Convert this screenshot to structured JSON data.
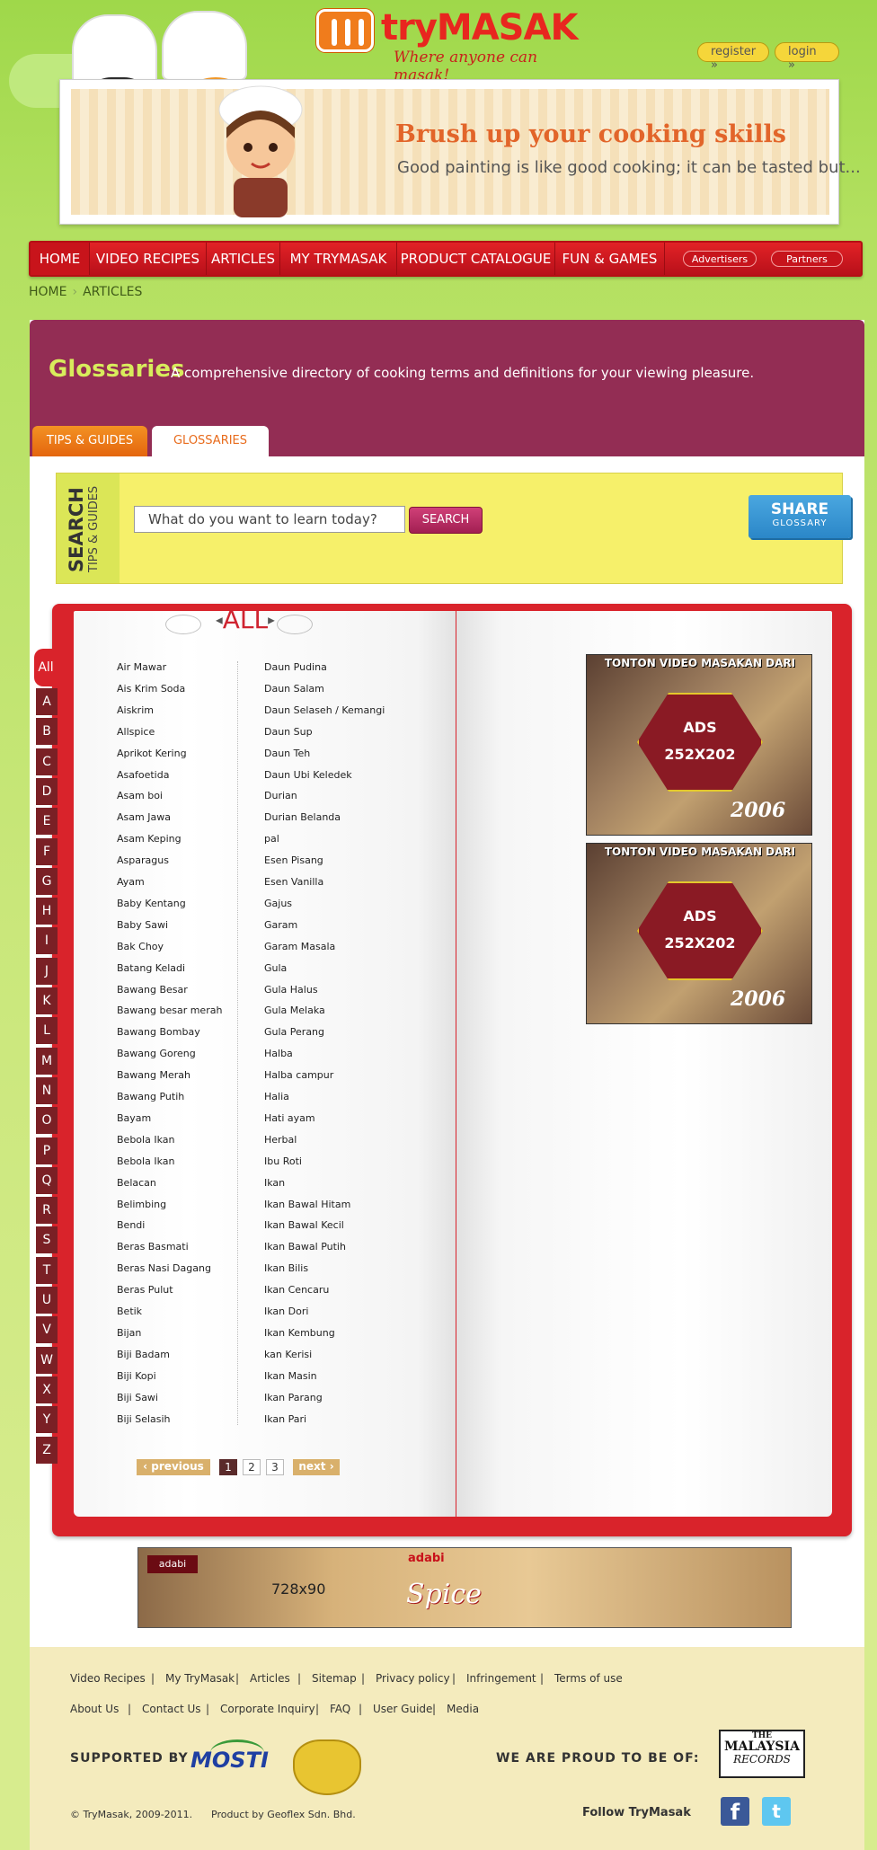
{
  "header": {
    "logo_text": "tryMASAK",
    "logo_tagline": "Where anyone can masak!",
    "register_label": "register »",
    "login_label": "login »"
  },
  "banner": {
    "title": "Brush up your cooking skills",
    "subtitle": "Good painting is like good cooking; it can be tasted but..."
  },
  "nav": {
    "items": [
      "HOME",
      "VIDEO RECIPES",
      "ARTICLES",
      "MY TRYMASAK",
      "PRODUCT CATALOGUE",
      "FUN & GAMES"
    ],
    "advertisers_label": "Advertisers",
    "partners_label": "Partners"
  },
  "breadcrumb": [
    "HOME",
    "ARTICLES"
  ],
  "section": {
    "title": "Glossaries",
    "description": "A comprehensive directory of cooking terms and definitions for your viewing pleasure."
  },
  "tabs": {
    "tips_label": "TIPS & GUIDES",
    "glossaries_label": "GLOSSARIES"
  },
  "search": {
    "side_title": "SEARCH",
    "side_subtitle": "TIPS & GUIDES",
    "input_value": "What do you want to learn today?",
    "button_label": "SEARCH",
    "share_title": "SHARE",
    "share_subtitle": "GLOSSARY"
  },
  "glossary": {
    "heading": "ALL",
    "letters": [
      "All",
      "A",
      "B",
      "C",
      "D",
      "E",
      "F",
      "G",
      "H",
      "I",
      "J",
      "K",
      "L",
      "M",
      "N",
      "O",
      "P",
      "Q",
      "R",
      "S",
      "T",
      "U",
      "V",
      "W",
      "X",
      "Y",
      "Z"
    ],
    "column1": [
      "Air Mawar",
      "Ais Krim Soda",
      "Aiskrim",
      "Allspice",
      "Aprikot Kering",
      "Asafoetida",
      "Asam boi",
      "Asam Jawa",
      "Asam Keping",
      "Asparagus",
      "Ayam",
      "Baby Kentang",
      "Baby Sawi",
      "Bak Choy",
      "Batang Keladi",
      "Bawang Besar",
      "Bawang besar merah",
      "Bawang Bombay",
      "Bawang Goreng",
      "Bawang Merah",
      "Bawang Putih",
      "Bayam",
      "Bebola Ikan",
      "Bebola Ikan",
      "Belacan",
      "Belimbing",
      "Bendi",
      "Beras Basmati",
      "Beras Nasi Dagang",
      "Beras Pulut",
      "Betik",
      "Bijan",
      "Biji Badam",
      "Biji Kopi",
      "Biji Sawi",
      "Biji Selasih"
    ],
    "column2": [
      "Daun Pudina",
      "Daun Salam",
      "Daun Selaseh / Kemangi",
      "Daun Sup",
      "Daun Teh",
      "Daun Ubi Keledek",
      "Durian",
      "Durian Belanda",
      " pal",
      "Esen Pisang",
      "Esen Vanilla",
      "Gajus",
      "Garam",
      "Garam Masala",
      "Gula",
      "Gula Halus",
      "Gula Melaka",
      "Gula Perang",
      "Halba",
      "Halba campur",
      "Halia",
      "Hati ayam",
      "Herbal",
      "Ibu Roti",
      "Ikan",
      "Ikan Bawal Hitam",
      "Ikan Bawal Kecil",
      "Ikan Bawal Putih",
      "Ikan Bilis",
      "Ikan Cencaru",
      "Ikan Dori",
      "Ikan Kembung",
      "kan Kerisi",
      "Ikan Masin",
      "Ikan Parang",
      "Ikan Pari"
    ]
  },
  "pagination": {
    "prev_label": "‹ previous",
    "next_label": "next ›",
    "pages": [
      "1",
      "2",
      "3"
    ],
    "current": "1"
  },
  "ads": {
    "side_top_text": "TONTON VIDEO MASAKAN DARI",
    "side_label_line1": "ADS",
    "side_label_line2": "252X202",
    "side_year": "2006",
    "banner_label": "728x90",
    "banner_logo": "adabi",
    "banner_brand": "adabi",
    "banner_spice": "Spice"
  },
  "footer": {
    "row1": [
      "Video Recipes",
      "My TryMasak",
      "Articles",
      "Sitemap",
      "Privacy policy",
      "Infringement",
      "Terms of use"
    ],
    "row2": [
      "About Us",
      "Contact Us",
      "Corporate Inquiry",
      "FAQ",
      "User Guide",
      "Media"
    ],
    "supported_by": "SUPPORTED BY",
    "mosti": "MOSTI",
    "proud": "WE ARE PROUD TO BE OF:",
    "mbr_line1": "THE",
    "mbr_line2": "MALAYSIA",
    "mbr_line3": "RECORDS",
    "copyright": "© TryMasak, 2009-2011.",
    "product_by": "Product by Geoflex Sdn. Bhd.",
    "follow": "Follow TryMasak",
    "facebook_glyph": "f",
    "twitter_glyph": "t"
  },
  "colors": {
    "brand_red": "#d9232b",
    "brand_orange": "#f07c1c",
    "section_purple": "#932d54",
    "search_yellow": "#f6f06a",
    "page_green": "#b3e060"
  }
}
